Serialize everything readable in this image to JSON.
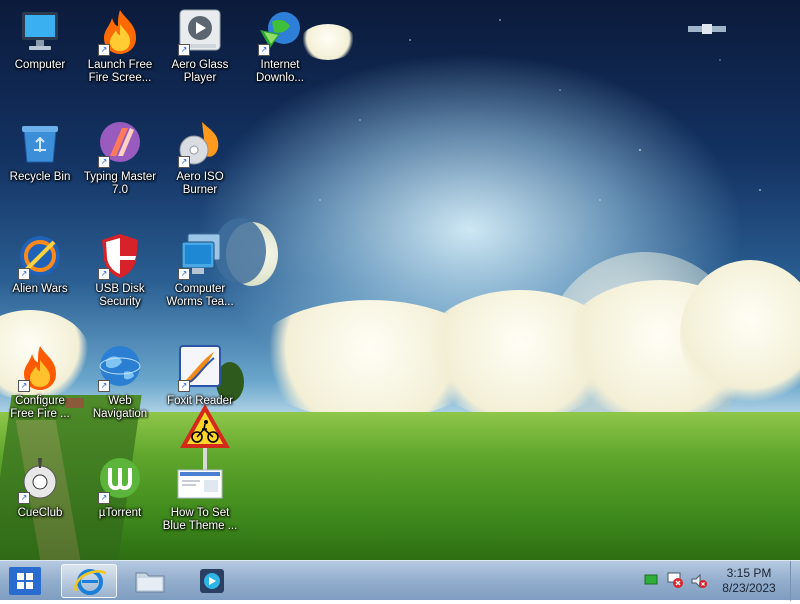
{
  "desktop_icons": [
    {
      "id": "computer",
      "label": "Computer",
      "icon": "monitor-icon"
    },
    {
      "id": "launch-free-fire",
      "label": "Launch Free\nFire Scree...",
      "icon": "flame-icon"
    },
    {
      "id": "aero-glass-player",
      "label": "Aero Glass\nPlayer",
      "icon": "media-player-icon"
    },
    {
      "id": "internet-download",
      "label": "Internet\nDownlo...",
      "icon": "globe-download-icon"
    },
    {
      "id": "recycle-bin",
      "label": "Recycle Bin",
      "icon": "recycle-bin-icon"
    },
    {
      "id": "typing-master",
      "label": "Typing Master\n7.0",
      "icon": "typing-master-icon"
    },
    {
      "id": "aero-iso-burner",
      "label": "Aero ISO\nBurner",
      "icon": "disc-flame-icon"
    },
    {
      "id": "alien-wars",
      "label": "Alien Wars",
      "icon": "alien-wars-icon"
    },
    {
      "id": "usb-disk-security",
      "label": "USB Disk\nSecurity",
      "icon": "shield-icon"
    },
    {
      "id": "computer-worms",
      "label": "Computer\nWorms Tea...",
      "icon": "monitors-icon"
    },
    {
      "id": "configure-free-fire",
      "label": "Configure\nFree Fire ...",
      "icon": "flame-icon"
    },
    {
      "id": "web-navigation",
      "label": "Web\nNavigation",
      "icon": "globe-icon"
    },
    {
      "id": "foxit-reader",
      "label": "Foxit Reader",
      "icon": "foxit-icon"
    },
    {
      "id": "cueclub",
      "label": "CueClub",
      "icon": "cue-ball-icon"
    },
    {
      "id": "utorrent",
      "label": "µTorrent",
      "icon": "utorrent-icon"
    },
    {
      "id": "how-to-set-blue-theme",
      "label": "How To Set\nBlue Theme ...",
      "icon": "document-thumbnail-icon"
    }
  ],
  "taskbar": {
    "start_icon": "windows-logo-icon",
    "pinned": [
      {
        "id": "internet-explorer",
        "icon": "internet-explorer-icon",
        "active": true
      },
      {
        "id": "file-explorer",
        "icon": "folder-icon",
        "active": false
      },
      {
        "id": "media-player",
        "icon": "media-player-icon",
        "active": false
      }
    ],
    "tray_icons": [
      "network-flag-icon",
      "action-center-icon",
      "volume-muted-icon"
    ],
    "clock": {
      "time": "3:15 PM",
      "date": "8/23/2023"
    }
  },
  "colors": {
    "accent": "#2a6bd0",
    "taskbar": "#93aecd",
    "label_text": "#ffffff"
  }
}
